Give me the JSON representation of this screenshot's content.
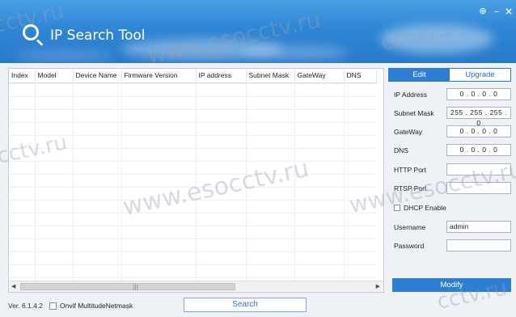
{
  "app": {
    "title": "IP Search Tool",
    "version": "Ver. 6.1.4.2"
  },
  "window_controls": {
    "globe": "⊕",
    "minimize": "–",
    "close": "×"
  },
  "table": {
    "columns": [
      "Index",
      "Model",
      "Device Name",
      "Firmware Version",
      "IP address",
      "Subnet Mask",
      "GateWay",
      "DNS"
    ]
  },
  "bottom": {
    "onvif_label": "Onvif MultitudeNetmask",
    "search_label": "Search"
  },
  "side": {
    "tabs": [
      "Edit",
      "Upgrade"
    ],
    "fields": {
      "ip_label": "IP Address",
      "ip_value": "0 . 0 . 0 . 0",
      "subnet_label": "Subnet Mask",
      "subnet_value": "255 . 255 . 255 . 0",
      "gateway_label": "GateWay",
      "gateway_value": "0 . 0 . 0 . 0",
      "dns_label": "DNS",
      "dns_value": "0 . 0 . 0 . 0",
      "http_label": "HTTP Port",
      "http_value": "",
      "rtsp_label": "RTSP Port",
      "rtsp_value": "",
      "dhcp_label": "DHCP Enable",
      "username_label": "Username",
      "username_value": "admin",
      "password_label": "Password",
      "password_value": ""
    },
    "modify_label": "Modify"
  },
  "watermark": "www.esocctv.ru",
  "watermark_short": "cctv.ru",
  "colors": {
    "accent": "#2e7ed4",
    "title_bar": "#3a8fdc"
  }
}
